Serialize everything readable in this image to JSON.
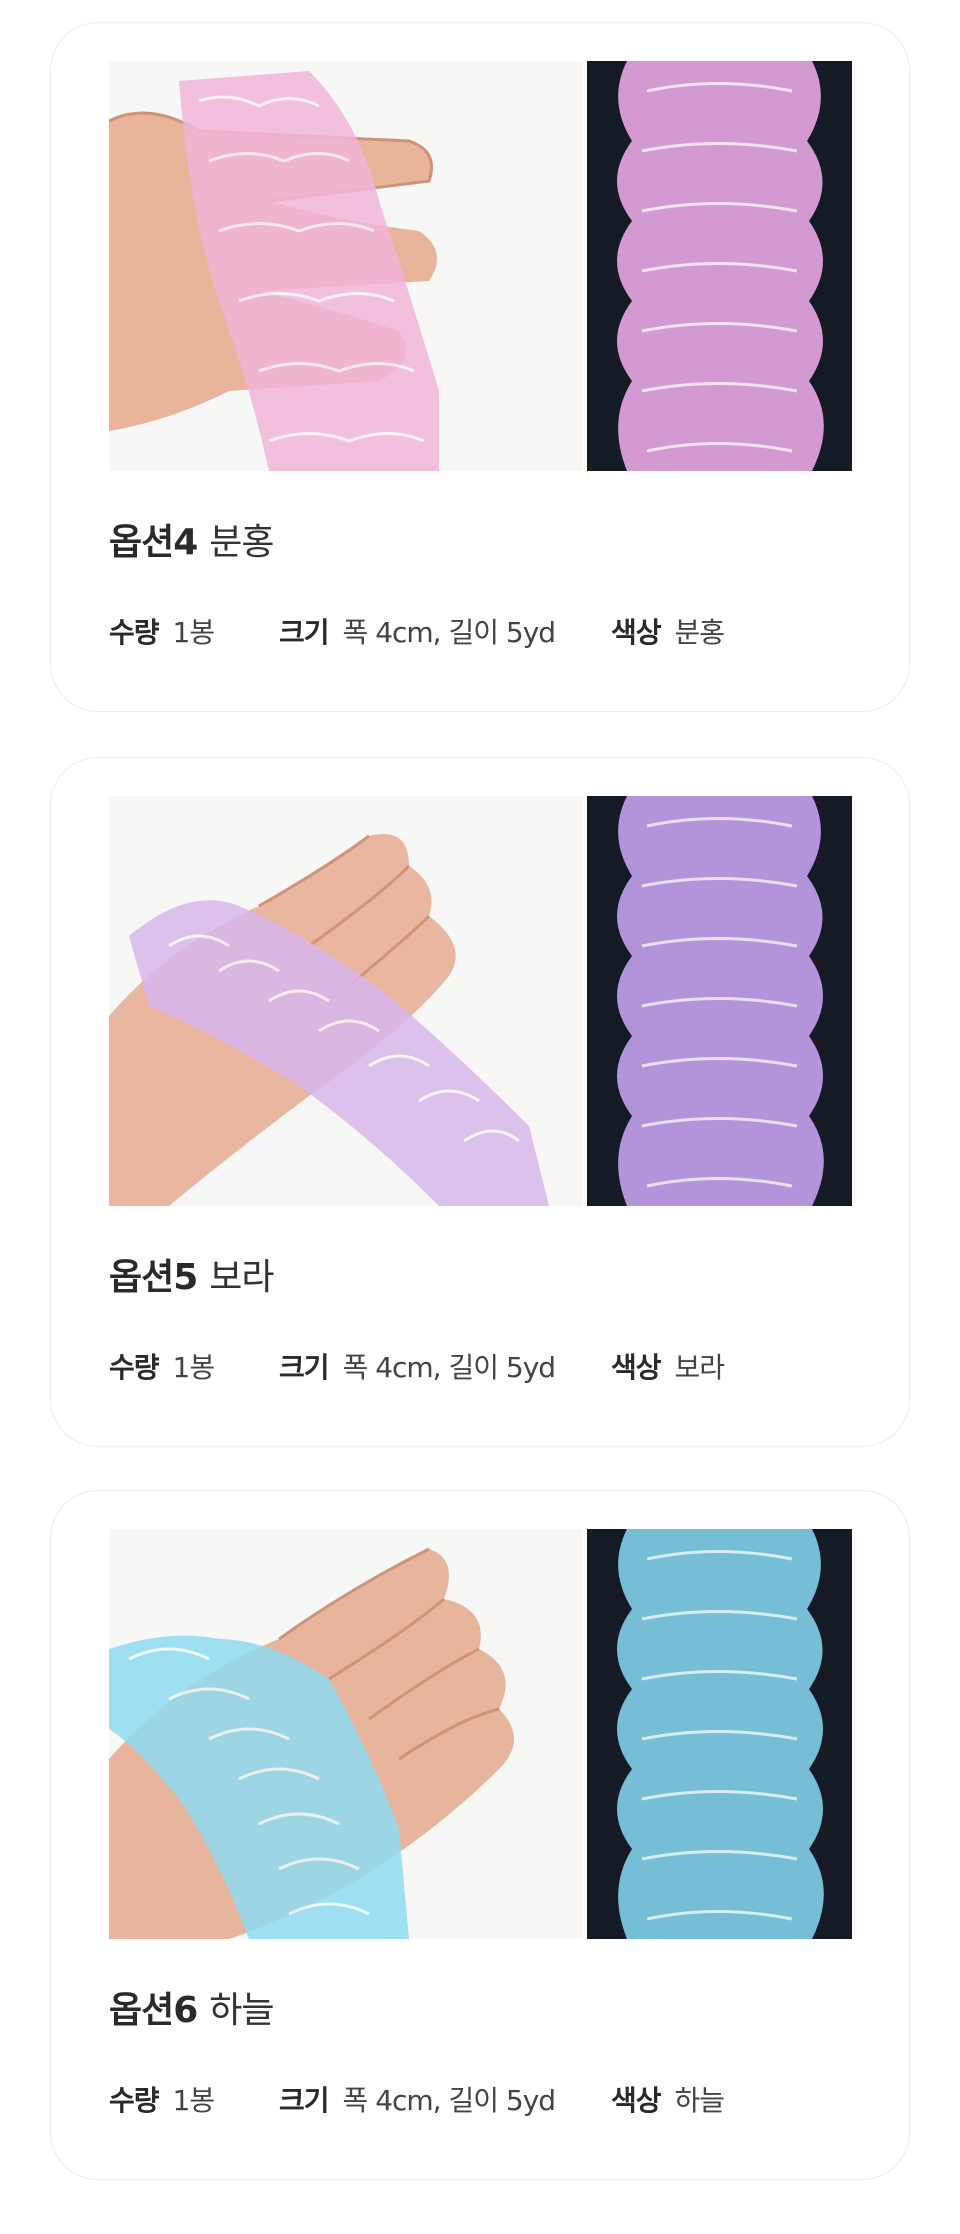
{
  "options": [
    {
      "label": "옵션4",
      "name": "분홍",
      "specs": {
        "qty_key": "수량",
        "qty_val": "1봉",
        "size_key": "크기",
        "size_val": "폭 4cm, 길이 5yd",
        "color_key": "색상",
        "color_val": "분홍"
      },
      "lace_color": "#f2b6d8",
      "lace_color_dark": "#e7a8e4"
    },
    {
      "label": "옵션5",
      "name": "보라",
      "specs": {
        "qty_key": "수량",
        "qty_val": "1봉",
        "size_key": "크기",
        "size_val": "폭 4cm, 길이 5yd",
        "color_key": "색상",
        "color_val": "보라"
      },
      "lace_color": "#d8b8ec",
      "lace_color_dark": "#c3a2ee"
    },
    {
      "label": "옵션6",
      "name": "하늘",
      "specs": {
        "qty_key": "수량",
        "qty_val": "1봉",
        "size_key": "크기",
        "size_val": "폭 4cm, 길이 5yd",
        "color_key": "색상",
        "color_val": "하늘"
      },
      "lace_color": "#8fdcf2",
      "lace_color_dark": "#7fd0ea"
    }
  ]
}
